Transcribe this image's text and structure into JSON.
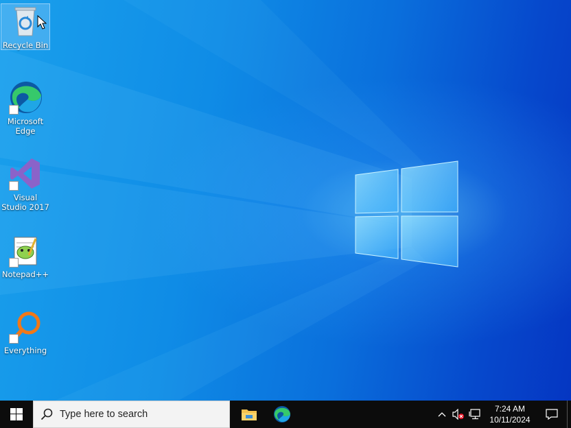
{
  "desktop": {
    "icons": [
      {
        "label": "Recycle Bin",
        "icon": "recycle-bin-icon"
      },
      {
        "label": "Microsoft Edge",
        "icon": "edge-icon"
      },
      {
        "label": "Visual Studio 2017",
        "icon": "visual-studio-icon"
      },
      {
        "label": "Notepad++",
        "icon": "notepad-plus-plus-icon"
      },
      {
        "label": "Everything",
        "icon": "everything-search-icon"
      }
    ]
  },
  "taskbar": {
    "search_placeholder": "Type here to search",
    "pinned": [
      {
        "name": "File Explorer",
        "icon": "file-explorer-icon"
      },
      {
        "name": "Microsoft Edge",
        "icon": "edge-icon"
      }
    ],
    "clock": {
      "time": "7:24 AM",
      "date": "10/11/2024"
    }
  },
  "colors": {
    "desktop_accent": "#0a6fdc",
    "taskbar": "#0c0c0c",
    "search_box": "#f3f3f3"
  }
}
